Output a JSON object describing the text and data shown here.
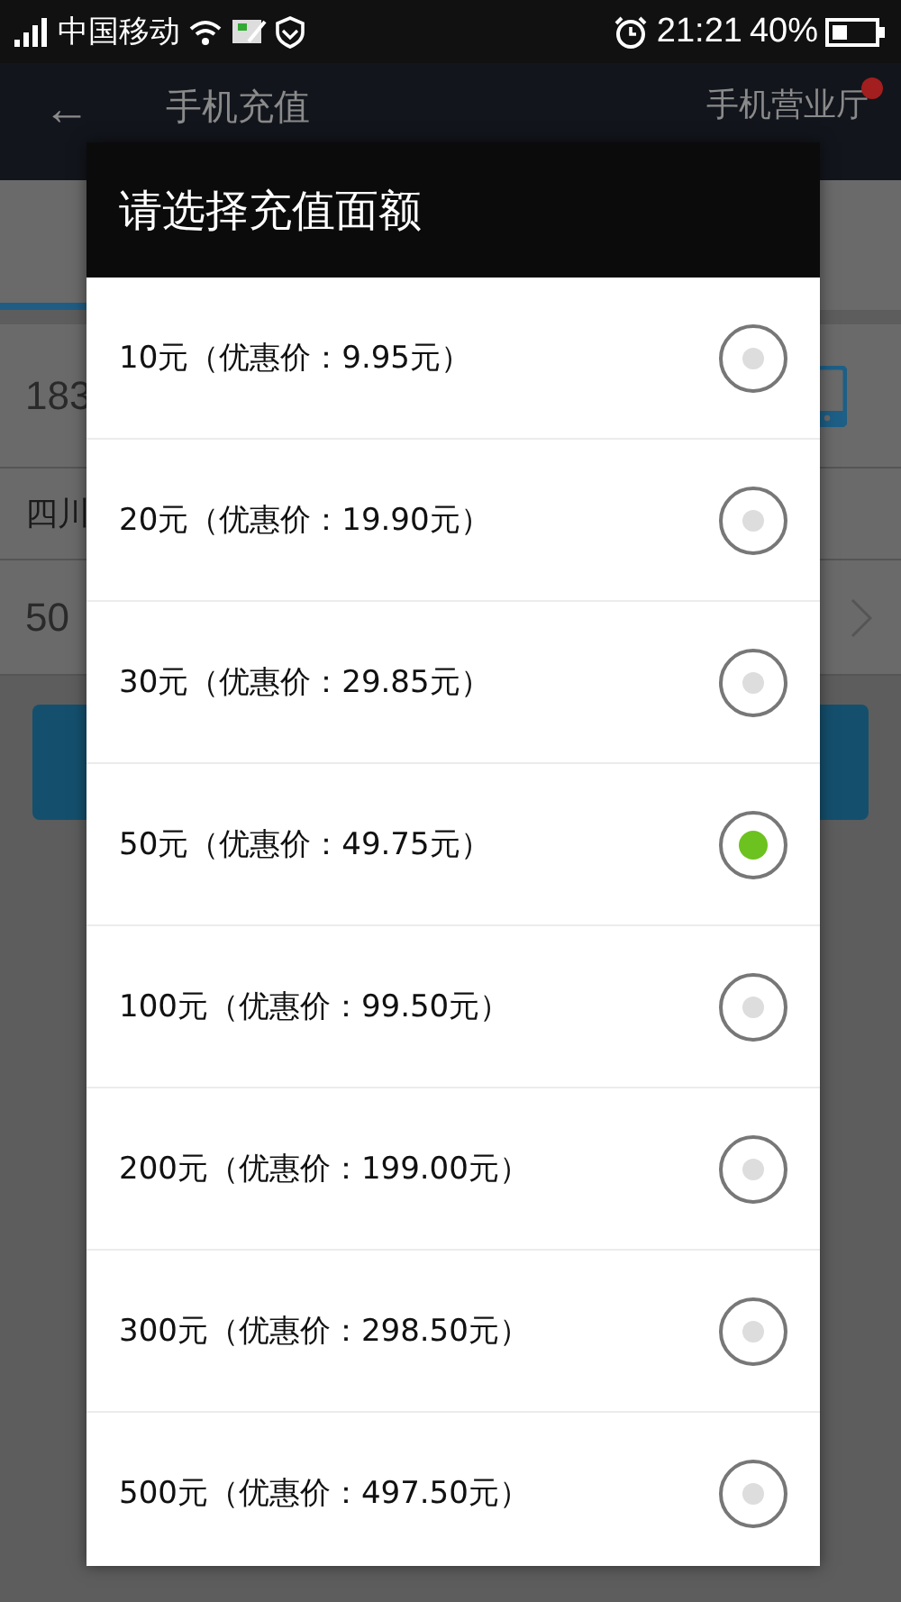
{
  "status_bar": {
    "carrier": "中国移动",
    "time": "21:21",
    "battery": "40%"
  },
  "app_bar": {
    "back": "←",
    "title": "手机充值",
    "action": "手机营业厅",
    "badge": true
  },
  "form": {
    "phone": "183",
    "region": "四川",
    "amount": "50"
  },
  "dialog": {
    "title": "请选择充值面额",
    "options": [
      {
        "label": "10元（优惠价：9.95元）",
        "selected": false
      },
      {
        "label": "20元（优惠价：19.90元）",
        "selected": false
      },
      {
        "label": "30元（优惠价：29.85元）",
        "selected": false
      },
      {
        "label": "50元（优惠价：49.75元）",
        "selected": true
      },
      {
        "label": "100元（优惠价：99.50元）",
        "selected": false
      },
      {
        "label": "200元（优惠价：199.00元）",
        "selected": false
      },
      {
        "label": "300元（优惠价：298.50元）",
        "selected": false
      },
      {
        "label": "500元（优惠价：497.50元）",
        "selected": false
      }
    ]
  }
}
